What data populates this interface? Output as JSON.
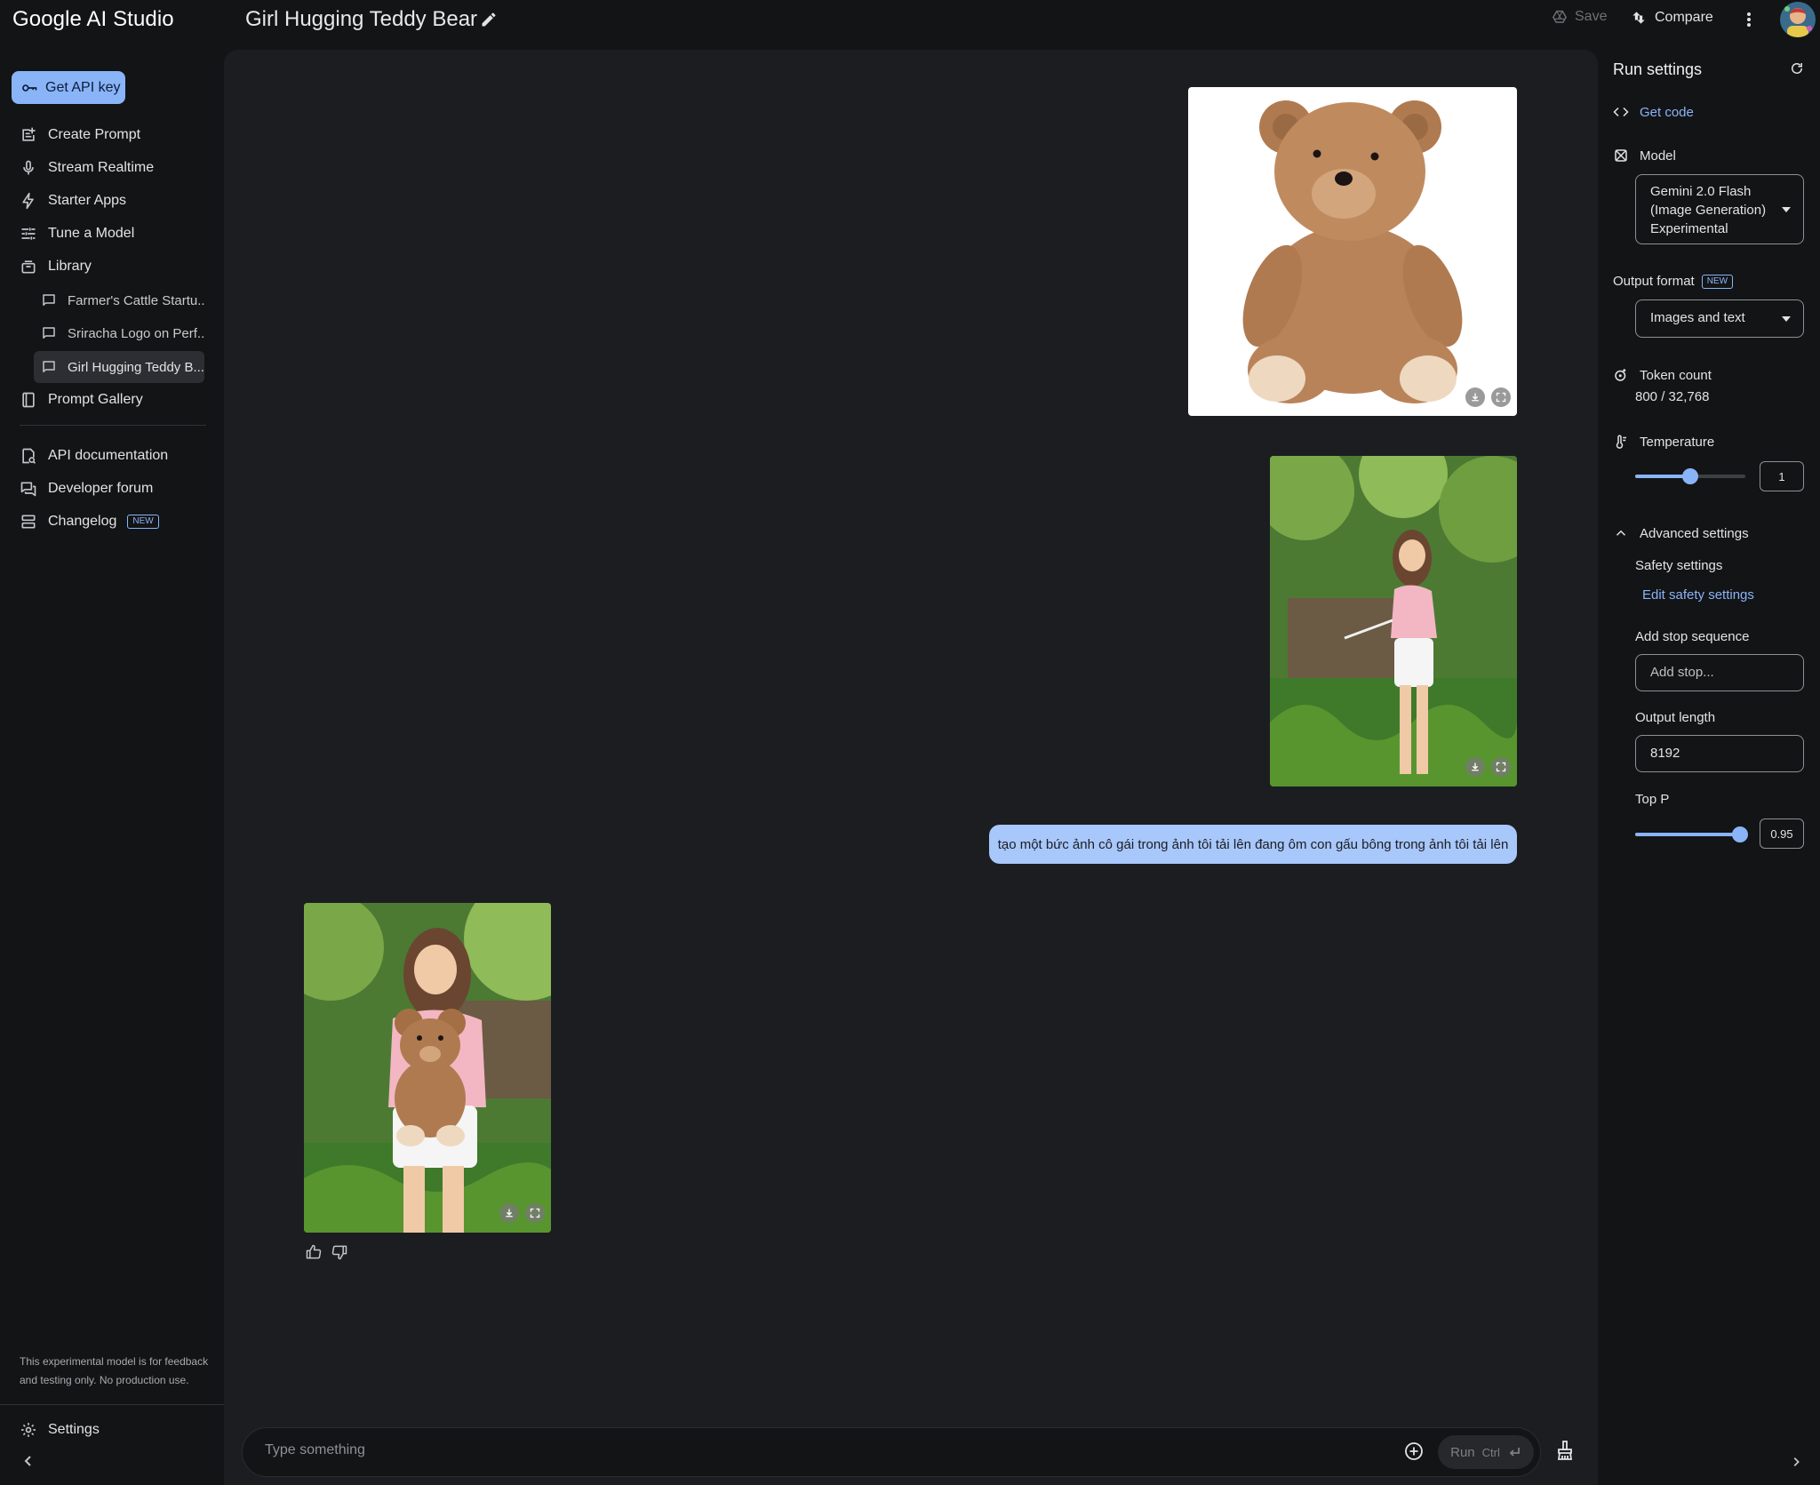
{
  "app": {
    "brand": "Google AI Studio",
    "title": "Girl Hugging Teddy Bear"
  },
  "topbar": {
    "save_label": "Save",
    "compare_label": "Compare"
  },
  "sidebar": {
    "get_api_key": "Get API key",
    "items": [
      {
        "label": "Create Prompt",
        "icon": "create-prompt-icon"
      },
      {
        "label": "Stream Realtime",
        "icon": "microphone-icon"
      },
      {
        "label": "Starter Apps",
        "icon": "bolt-icon"
      },
      {
        "label": "Tune a Model",
        "icon": "tune-icon"
      },
      {
        "label": "Library",
        "icon": "library-icon"
      }
    ],
    "library": [
      {
        "label": "Farmer's Cattle Startu..."
      },
      {
        "label": "Sriracha Logo on Perf..."
      },
      {
        "label": "Girl Hugging Teddy B...",
        "active": true
      }
    ],
    "prompt_gallery": "Prompt Gallery",
    "resources": [
      {
        "label": "API documentation",
        "icon": "api-docs-icon"
      },
      {
        "label": "Developer forum",
        "icon": "forum-icon"
      },
      {
        "label": "Changelog",
        "icon": "changelog-icon",
        "badge": "NEW"
      }
    ],
    "disclaimer": "This experimental model is for feedback and testing only. No production use.",
    "settings_label": "Settings"
  },
  "chat": {
    "user_prompt": "tạo một bức ảnh cô gái trong ảnh tôi tải lên đang ôm con gấu bông trong ảnh tôi tải lên",
    "input_placeholder": "Type something",
    "run_label": "Run",
    "run_shortcut": "Ctrl"
  },
  "run_settings": {
    "title": "Run settings",
    "get_code": "Get code",
    "model_label": "Model",
    "model_value": [
      "Gemini 2.0 Flash",
      "(Image Generation)",
      "Experimental"
    ],
    "output_format_label": "Output format",
    "output_format_badge": "NEW",
    "output_format_value": "Images and text",
    "token_count_label": "Token count",
    "token_count_value": "800 / 32,768",
    "temperature_label": "Temperature",
    "temperature_value": "1",
    "temperature_level": 0.5,
    "advanced_label": "Advanced settings",
    "safety_label": "Safety settings",
    "edit_safety": "Edit safety settings",
    "stop_seq_label": "Add stop sequence",
    "stop_seq_placeholder": "Add stop...",
    "output_length_label": "Output length",
    "output_length_value": "8192",
    "top_p_label": "Top P",
    "top_p_value": "0.95",
    "top_p_level": 0.95
  },
  "colors": {
    "accent": "#8ab4f8",
    "bubble": "#a8c7fa",
    "panel": "#1c1d21",
    "background": "#131416"
  }
}
